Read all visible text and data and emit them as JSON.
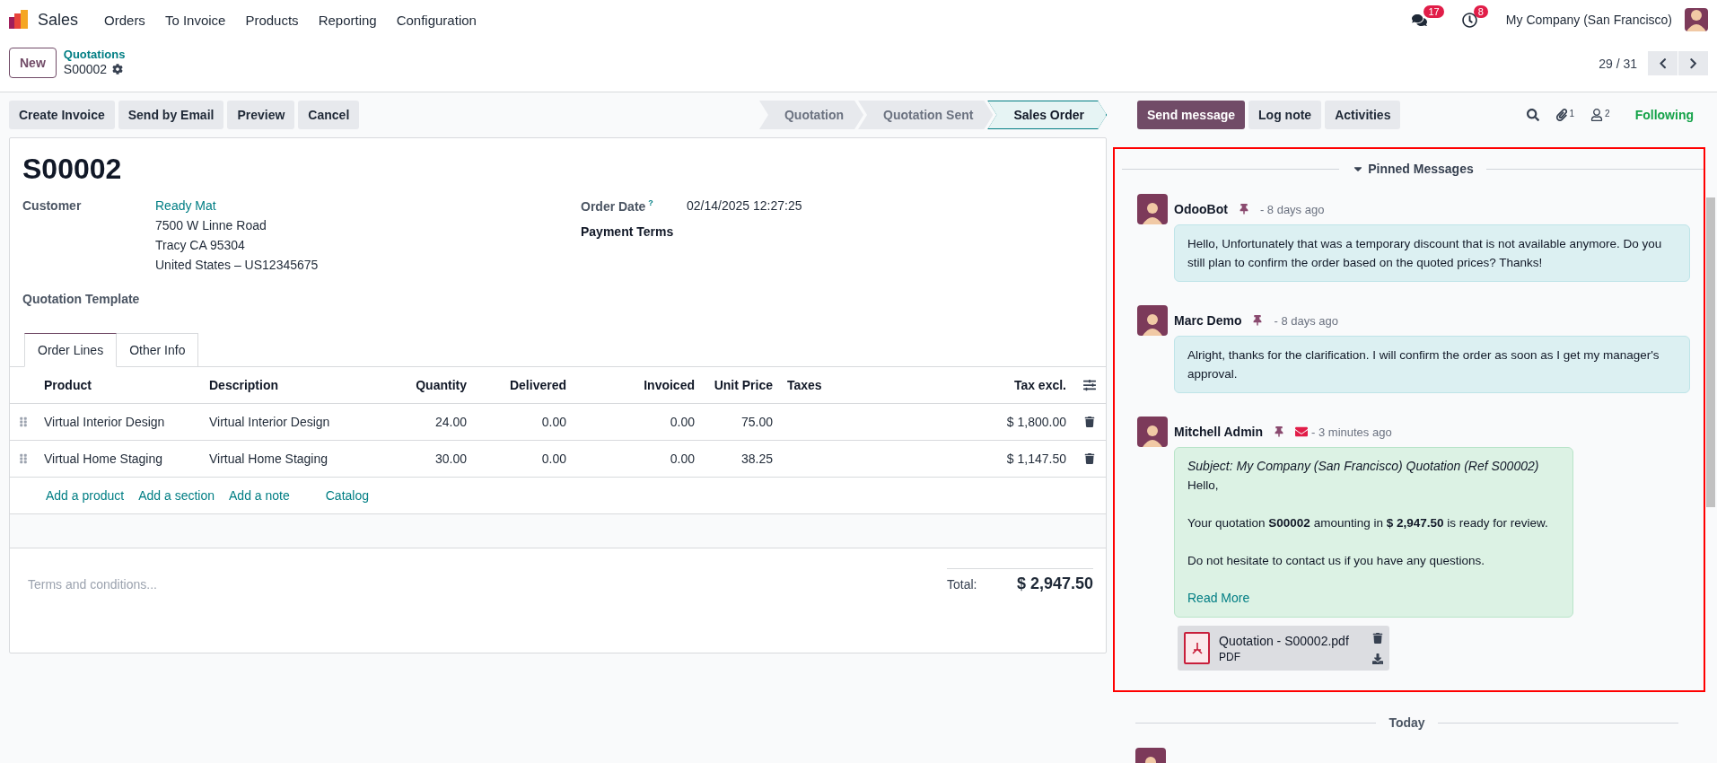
{
  "app": {
    "name": "Sales",
    "menu": [
      "Orders",
      "To Invoice",
      "Products",
      "Reporting",
      "Configuration"
    ]
  },
  "systray": {
    "messages_count": "17",
    "activities_count": "8",
    "company": "My Company (San Francisco)"
  },
  "control_panel": {
    "new_button": "New",
    "breadcrumb": "Quotations",
    "record": "S00002",
    "pager": "29 / 31"
  },
  "actions": [
    "Create Invoice",
    "Send by Email",
    "Preview",
    "Cancel"
  ],
  "stages": [
    {
      "label": "Quotation",
      "selected": false
    },
    {
      "label": "Quotation Sent",
      "selected": false
    },
    {
      "label": "Sales Order",
      "selected": true
    }
  ],
  "form": {
    "title": "S00002",
    "customer": {
      "label": "Customer",
      "name": "Ready Mat",
      "address": [
        "7500 W Linne Road",
        "Tracy CA 95304",
        "United States – US12345675"
      ]
    },
    "quotation_template": {
      "label": "Quotation Template"
    },
    "order_date": {
      "label": "Order Date",
      "help": "?",
      "value": "02/14/2025 12:27:25"
    },
    "payment_terms": {
      "label": "Payment Terms"
    },
    "tabs": [
      {
        "label": "Order Lines",
        "selected": true
      },
      {
        "label": "Other Info",
        "selected": false
      }
    ],
    "table": {
      "columns": [
        {
          "label": "Product",
          "kind": "text"
        },
        {
          "label": "Description",
          "kind": "text"
        },
        {
          "label": "Quantity",
          "kind": "number"
        },
        {
          "label": "Delivered",
          "kind": "number"
        },
        {
          "label": "Invoiced",
          "kind": "number"
        },
        {
          "label": "Unit Price",
          "kind": "number"
        },
        {
          "label": "Taxes",
          "kind": "text"
        },
        {
          "label": "Tax excl.",
          "kind": "number"
        }
      ],
      "rows": [
        [
          "Virtual Interior Design",
          "Virtual Interior Design",
          "24.00",
          "0.00",
          "0.00",
          "75.00",
          "",
          "$ 1,800.00"
        ],
        [
          "Virtual Home Staging",
          "Virtual Home Staging",
          "30.00",
          "0.00",
          "0.00",
          "38.25",
          "",
          "$ 1,147.50"
        ]
      ],
      "add_links": [
        "Add a product",
        "Add a section",
        "Add a note",
        "Catalog"
      ]
    },
    "terms_placeholder": "Terms and conditions...",
    "total": {
      "label": "Total:",
      "value": "$ 2,947.50"
    }
  },
  "chatter": {
    "buttons": [
      {
        "label": "Send message",
        "primary": true
      },
      {
        "label": "Log note",
        "primary": false
      },
      {
        "label": "Activities",
        "primary": false
      }
    ],
    "attachments_count": "1",
    "followers_count": "2",
    "follow_status": "Following",
    "pinned": {
      "title": "Pinned Messages",
      "expanded": true,
      "messages": [
        {
          "author": "OdooBot",
          "time": "- 8 days ago",
          "kind": "comment",
          "email": false,
          "body": [
            "Hello, Unfortunately that was a temporary discount that is not available anymore. Do you still plan to confirm the order based on the quoted prices? Thanks!"
          ]
        },
        {
          "author": "Marc Demo",
          "time": "- 8 days ago",
          "kind": "comment",
          "email": false,
          "body": [
            "Alright, thanks for the clarification. I will confirm the order as soon as I get my manager's approval."
          ]
        },
        {
          "author": "Mitchell Admin",
          "time": "- 3 minutes ago",
          "kind": "email",
          "email": true,
          "subject": "Subject: My Company (San Francisco) Quotation (Ref S00002)",
          "body": [
            "Hello,",
            "Your quotation **S00002** amounting in **$ 2,947.50** is ready for review.",
            "Do not hesitate to contact us if you have any questions."
          ],
          "read_more": "Read More",
          "attachment": {
            "name": "Quotation - S00002.pdf",
            "type": "PDF"
          }
        }
      ]
    },
    "separator": "Today"
  }
}
